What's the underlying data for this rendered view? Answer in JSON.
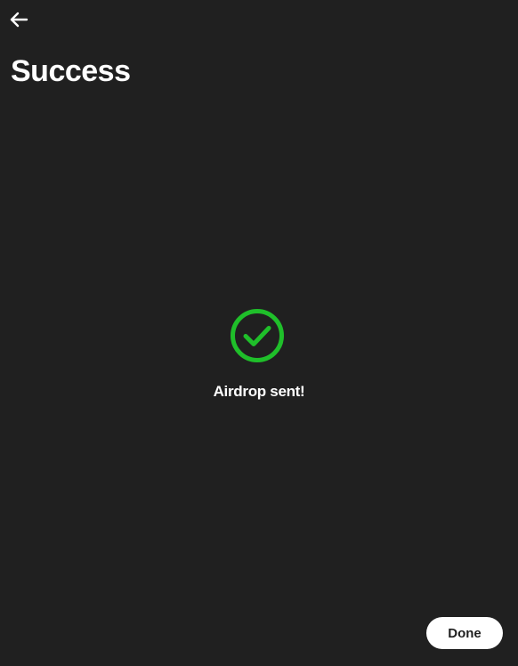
{
  "header": {
    "back_icon": "arrow-left-icon",
    "title": "Success"
  },
  "main": {
    "status_icon": "check-circle-icon",
    "message": "Airdrop sent!"
  },
  "footer": {
    "done_label": "Done"
  },
  "colors": {
    "background": "#202020",
    "text": "#ffffff",
    "success": "#1fbf2a",
    "button_bg": "#ffffff",
    "button_text": "#1f1f1f"
  }
}
